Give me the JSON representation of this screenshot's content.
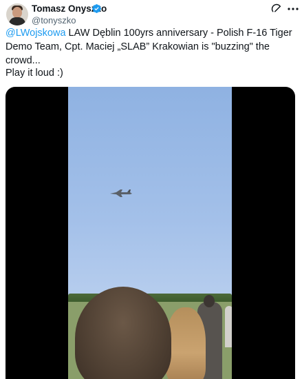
{
  "author": {
    "name": "Tomasz Onyszko",
    "handle": "@tonyszko"
  },
  "icons": {
    "avatar": "avatar-photo",
    "verified": "verified-badge-icon",
    "grok": "grok-icon",
    "more": "more-icon"
  },
  "colors": {
    "link": "#1d9bf0",
    "text": "#0f1419",
    "secondary": "#536471",
    "verified": "#1d9bf0"
  },
  "tweet": {
    "mention": "@LWojskowa",
    "text_rest": " LAW Dęblin 100yrs  anniversary - Polish F-16 Tiger Demo Team, Cpt. Maciej „SLAB” Krakowian is \"buzzing\" the crowd...",
    "line2": "Play it loud :)"
  }
}
